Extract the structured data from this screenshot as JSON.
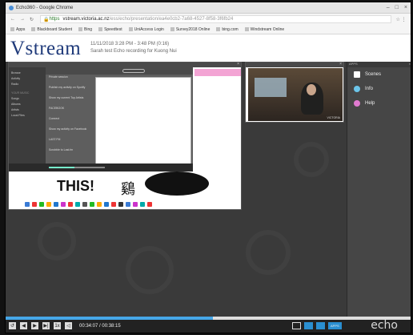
{
  "browser": {
    "title": "Echo360 - Google Chrome",
    "address": {
      "protocol": "https",
      "host": "vstream.victoria.ac.nz",
      "path": "/ess/echo/presentation/ea4e0cb2-7a68-4527-8f58-3f6fb24"
    },
    "bookmarks": [
      "Apps",
      "Blackboard Student",
      "Bing",
      "Speedtest",
      "UniAccess Login",
      "Survey2018 Online",
      "bing.com",
      "Windstream Online"
    ]
  },
  "header": {
    "logo": "Vstream",
    "timestamp": "11/11/2018 3:28 PM - 3:48 PM (0:16)",
    "subtitle": "Sarah test Echo recording for Kuong Nui"
  },
  "screen": {
    "spotify": {
      "sidebar": [
        "Browse",
        "Activity",
        "Radio"
      ],
      "sidebar_heading": "YOUR MUSIC",
      "sidebar_more": [
        "Songs",
        "Albums",
        "Artists",
        "Local Files"
      ],
      "content_rows": [
        "Private session",
        "Publish my activity on Spotify",
        "Show my current Top Artists",
        "FACEBOOK",
        "Connect",
        "Show my activity on Facebook",
        "LAST.FM",
        "Scrobble to Last.fm"
      ]
    },
    "slide_text": "THIS!",
    "slide_kanji": "鷄"
  },
  "webcam": {
    "label": "VICTORIA"
  },
  "apps": {
    "header": "APPS",
    "items": [
      {
        "label": "Scenes",
        "icon": "scenes-icon"
      },
      {
        "label": "Info",
        "icon": "info-icon"
      },
      {
        "label": "Help",
        "icon": "help-icon"
      }
    ]
  },
  "player": {
    "time_current": "00:34:07",
    "time_total": "00:38:15",
    "progress": 0.51,
    "apps_label": "APPS",
    "brand": "echo"
  },
  "colors": {
    "accent": "#46a7e8",
    "logo": "#1f3a7a",
    "info": "#6cc5ea",
    "help": "#e07ad0"
  }
}
